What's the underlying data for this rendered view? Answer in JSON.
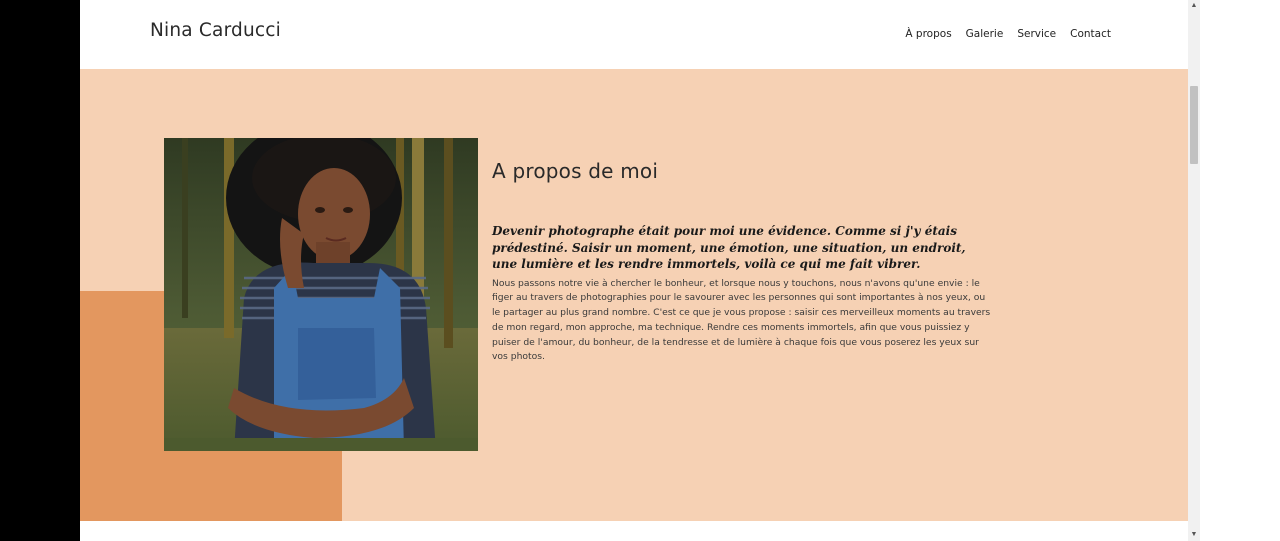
{
  "header": {
    "brand": "Nina Carducci",
    "nav": [
      {
        "label": "À propos"
      },
      {
        "label": "Galerie"
      },
      {
        "label": "Service"
      },
      {
        "label": "Contact"
      }
    ]
  },
  "about": {
    "title": "A propos de moi",
    "quote": "Devenir photographe était pour moi une évidence. Comme si j'y étais prédestiné. Saisir un moment, une émotion, une situation, un endroit, une lumière et les rendre immortels, voilà ce qui me fait vibrer.",
    "body": "Nous passons notre vie à chercher le bonheur, et lorsque nous y touchons, nous n'avons qu'une envie : le figer au travers de photographies pour le savourer avec les personnes qui sont importantes à nos yeux, ou le partager au plus grand nombre. C'est ce que je vous propose : saisir ces merveilleux moments au travers de mon regard, mon approche, ma technique. Rendre ces moments immortels, afin que vous puissiez y puiser de l'amour, du bonheur, de la tendresse et de lumière à chaque fois que vous poserez les yeux sur vos photos.",
    "photo_icon": "portrait-photo"
  },
  "colors": {
    "section_bg": "#f6d1b4",
    "accent": "#e3975f"
  },
  "scrollbar": {
    "up_icon": "▲",
    "down_icon": "▼"
  }
}
